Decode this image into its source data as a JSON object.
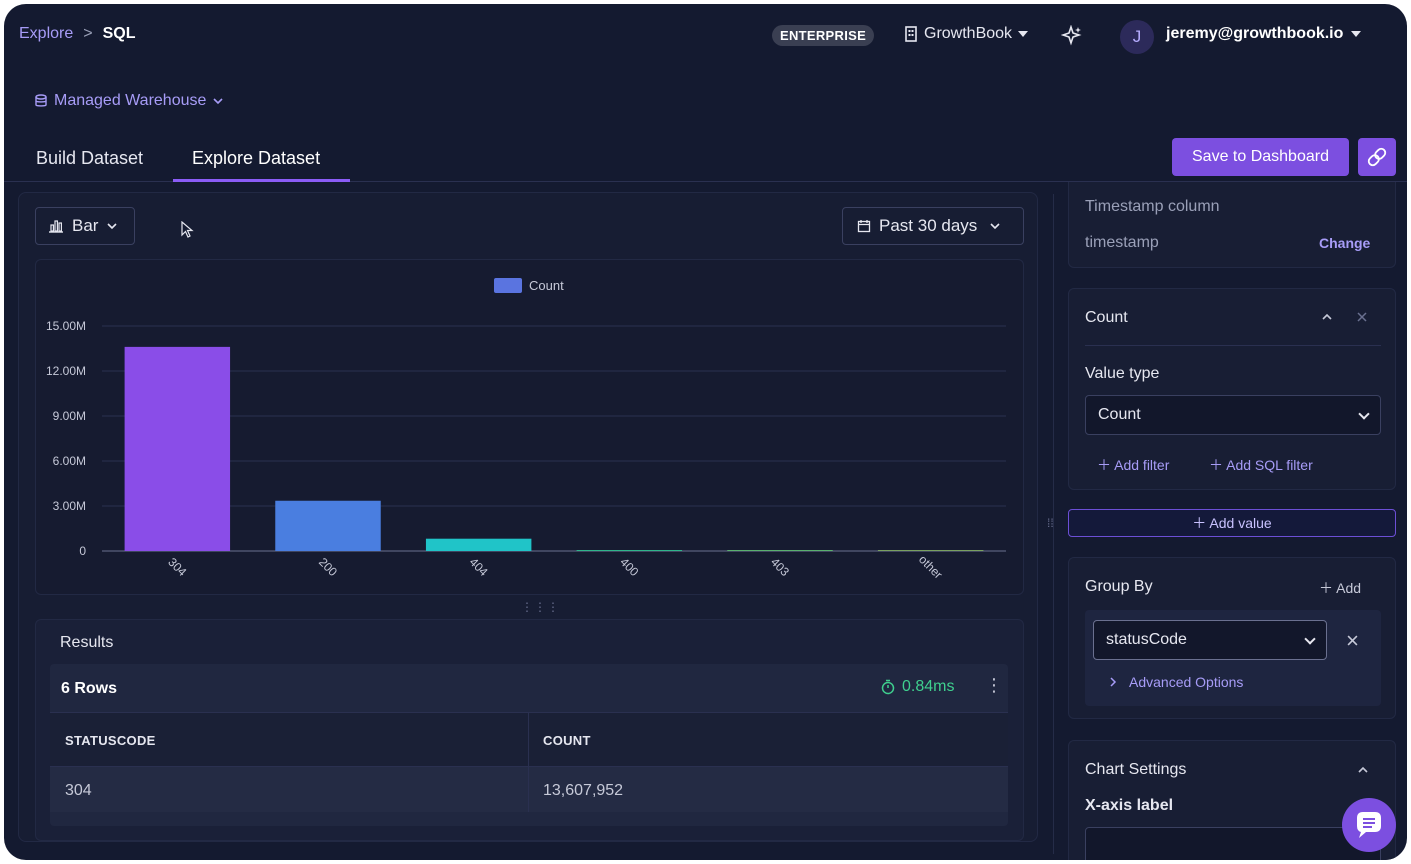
{
  "breadcrumb": {
    "root": "Explore",
    "separator": ">",
    "current": "SQL"
  },
  "header": {
    "plan_badge": "ENTERPRISE",
    "org_name": "GrowthBook",
    "avatar_initial": "J",
    "user_email": "jeremy@growthbook.io"
  },
  "warehouse": {
    "label": "Managed Warehouse"
  },
  "tabs": [
    {
      "label": "Build Dataset",
      "active": false
    },
    {
      "label": "Explore Dataset",
      "active": true
    }
  ],
  "actions": {
    "save_label": "Save to Dashboard"
  },
  "chart_controls": {
    "chart_type": "Bar",
    "date_range": "Past 30 days"
  },
  "chart_data": {
    "type": "bar",
    "legend": [
      "Count"
    ],
    "legend_position": "top-center",
    "categories": [
      "304",
      "200",
      "404",
      "400",
      "403",
      "other"
    ],
    "series": [
      {
        "name": "Count",
        "values": [
          13607952,
          3350000,
          820000,
          60000,
          20000,
          10000
        ]
      }
    ],
    "bar_colors": [
      "#8a4de8",
      "#4a7ee0",
      "#20c4c8",
      "#2fb58a",
      "#5ab06e",
      "#7aa060"
    ],
    "y_ticks": [
      "15.00M",
      "12.00M",
      "9.00M",
      "6.00M",
      "3.00M",
      "0"
    ],
    "ylim": [
      0,
      15000000
    ],
    "grid": true
  },
  "results": {
    "title": "Results",
    "row_count": "6 Rows",
    "timing": "0.84ms",
    "columns": [
      "STATUSCODE",
      "COUNT"
    ],
    "rows": [
      [
        "304",
        "13,607,952"
      ]
    ]
  },
  "right_panel": {
    "timestamp": {
      "label": "Timestamp column",
      "value": "timestamp",
      "change_label": "Change"
    },
    "value_card": {
      "title": "Count",
      "value_type_label": "Value type",
      "value_type_selected": "Count",
      "add_filter": "Add filter",
      "add_sql_filter": "Add SQL filter"
    },
    "add_value": "Add value",
    "group_by": {
      "title": "Group By",
      "add_label": "Add",
      "selected": "statusCode",
      "advanced": "Advanced Options"
    },
    "chart_settings": {
      "title": "Chart Settings",
      "x_axis_label": "X-axis label"
    }
  },
  "colors": {
    "accent": "#7c4fe0",
    "background": "#141a30",
    "success": "#3fcf8e"
  }
}
